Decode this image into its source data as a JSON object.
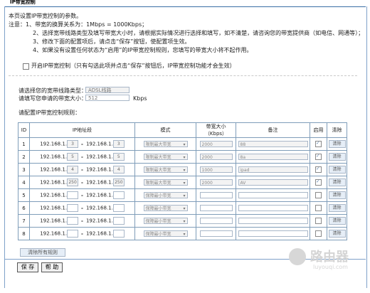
{
  "header": {
    "title": "IP带宽控制"
  },
  "intro": "本页设置IP带宽控制的参数。",
  "notes": {
    "head": "注意：1、带宽的换算关系为：1Mbps = 1000Kbps；",
    "n2": "2、选择宽带线路类型及填写带宽大小时，请根据实际情况进行选择和填写，如不清楚，请咨询您的带宽提供商（如电信、网通等）；",
    "n3": "3、修改下面的配置项后，请点击“保存”按钮，使配置项生效。",
    "n4": "4、如果没有设置任何状态为“启用”的IP带宽控制规则，您填写的带宽大小将不起作用。"
  },
  "enable": {
    "checked": false,
    "label": "开启IP带宽控制（只有勾选此项并点击“保存”按钮后，IP带宽控制功能才会生效）"
  },
  "line_type": {
    "label": "请选择您的宽带线路类型：",
    "value": "ADSL线路"
  },
  "bandwidth": {
    "label": "请填写您申请的带宽大小：",
    "value": "512",
    "unit": "Kbps"
  },
  "rules_label": "请配置IP带宽控制规则：",
  "table": {
    "headers": [
      "ID",
      "IP地址段",
      "模式",
      "带宽大小（Kbps）",
      "备注",
      "启用",
      "清除"
    ],
    "ip_prefix": "192.168.1.",
    "rows": [
      {
        "id": "1",
        "start": "3",
        "end": "3",
        "mode": "限制最大带宽",
        "bandwidth": "2000",
        "note": "88",
        "enabled": true,
        "clear": "清除"
      },
      {
        "id": "2",
        "start": "5",
        "end": "5",
        "mode": "限制最大带宽",
        "bandwidth": "2000",
        "note": "8a",
        "enabled": true,
        "clear": "清除"
      },
      {
        "id": "3",
        "start": "4",
        "end": "4",
        "mode": "限制最大带宽",
        "bandwidth": "1000",
        "note": "ipad",
        "enabled": true,
        "clear": "清除"
      },
      {
        "id": "4",
        "start": "250",
        "end": "250",
        "mode": "限制最大带宽",
        "bandwidth": "2000",
        "note": "AV",
        "enabled": true,
        "clear": "清除"
      },
      {
        "id": "5",
        "start": "",
        "end": "",
        "mode": "保障最小带宽",
        "bandwidth": "",
        "note": "",
        "enabled": false,
        "clear": "清除"
      },
      {
        "id": "6",
        "start": "",
        "end": "",
        "mode": "保障最小带宽",
        "bandwidth": "",
        "note": "",
        "enabled": false,
        "clear": "清除"
      },
      {
        "id": "7",
        "start": "",
        "end": "",
        "mode": "保障最小带宽",
        "bandwidth": "",
        "note": "",
        "enabled": false,
        "clear": "清除"
      },
      {
        "id": "8",
        "start": "",
        "end": "",
        "mode": "保障最小带宽",
        "bandwidth": "",
        "note": "",
        "enabled": false,
        "clear": "清除"
      }
    ]
  },
  "clear_all": "清除所有规则",
  "buttons": {
    "save": "保 存",
    "help": "帮 助"
  },
  "watermark": {
    "name": "路由器",
    "url": "luyouqi.com"
  }
}
